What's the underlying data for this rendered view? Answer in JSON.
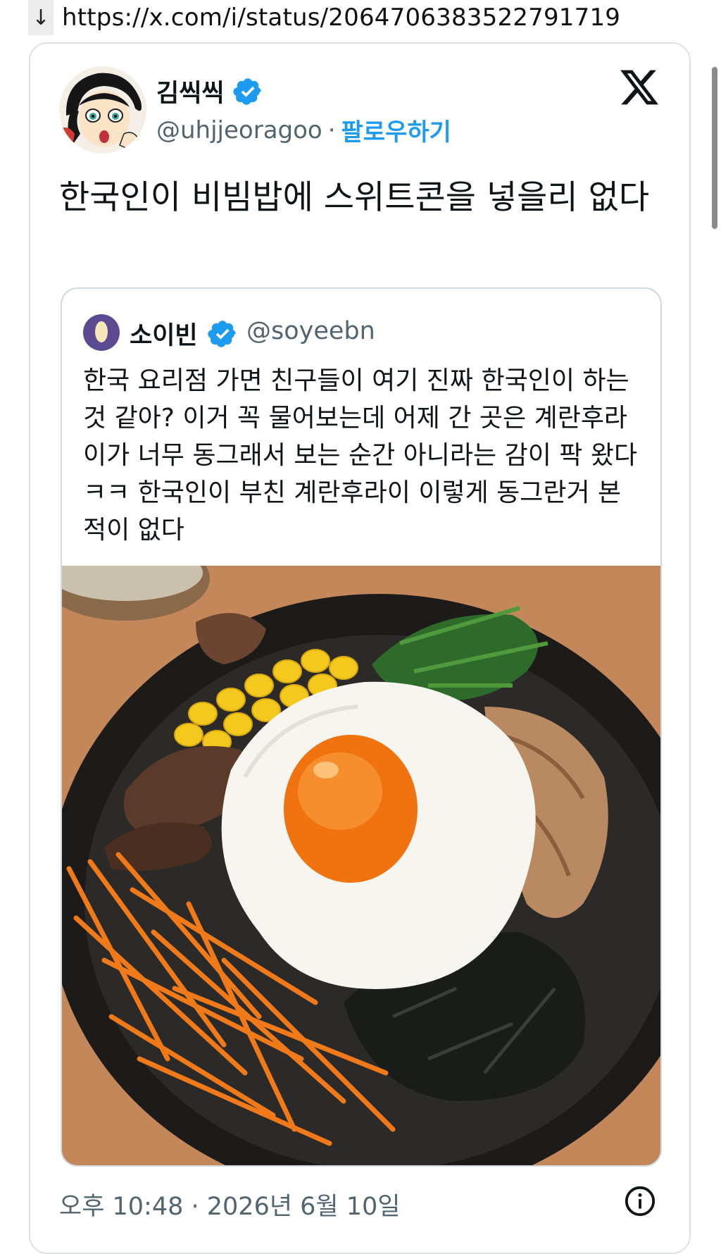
{
  "url_bar": {
    "download_arrow": "↓",
    "url": "https://x.com/i/status/2064706383522791719"
  },
  "tweet": {
    "author_name": "김씩씩",
    "handle": "@uhjjeoragoo",
    "separator": "·",
    "follow_label": "팔로우하기",
    "text": "한국인이 비빔밥에 스위트콘을 넣을리 없다",
    "timestamp": "오후 10:48 · 2026년 6월 10일"
  },
  "quoted_tweet": {
    "author_name": "소이빈",
    "handle": "@soyeebn",
    "text": "한국 요리점 가면 친구들이 여기 진짜 한국인이 하는 것 같아? 이거 꼭 물어보는데 어제 간 곳은 계란후라이가 너무 동그래서 보는 순간 아니라는 감이 팍 왔다ㅋㅋ 한국인이 부친 계란후라이 이렇게 동그란거 본 적이 없다",
    "photo": "bibimbap-bowl-with-fried-egg"
  },
  "icons": {
    "verified": "verified-badge-icon",
    "x_logo": "x-logo-icon",
    "info": "info-icon"
  },
  "colors": {
    "accent": "#1d9bf0",
    "secondary_text": "#536471",
    "border": "#cfd9de"
  }
}
